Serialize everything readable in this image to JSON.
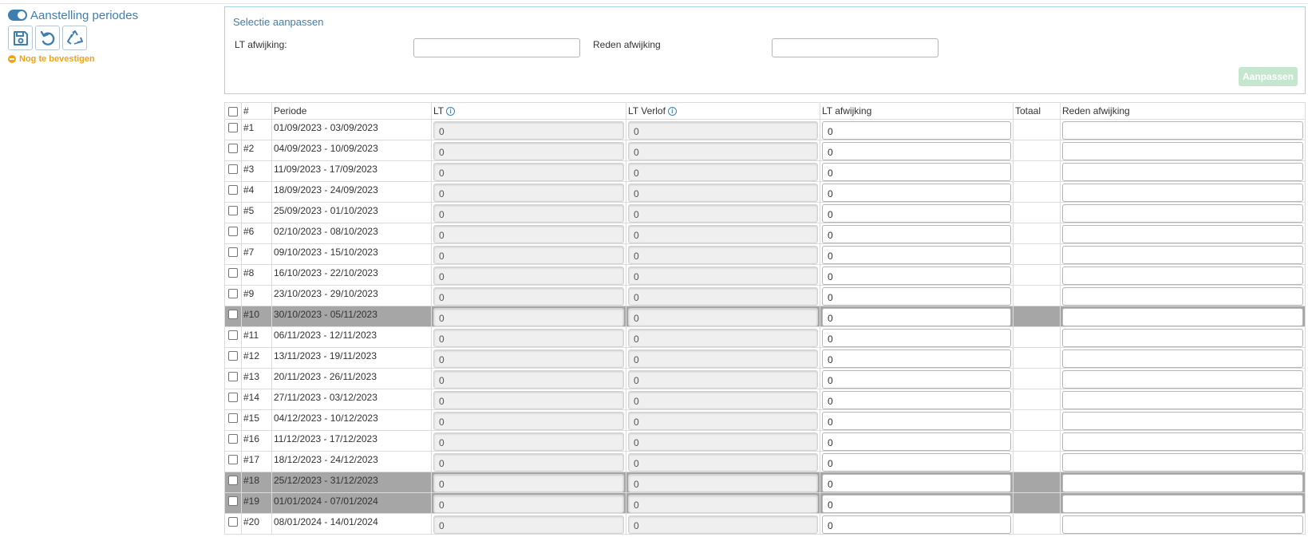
{
  "left": {
    "title": "Aanstelling periodes",
    "toggle_icon": "toggle-icon",
    "buttons": [
      "save-icon",
      "undo-icon",
      "recycle-icon"
    ],
    "status": "Nog te bevestigen",
    "status_color": "#f0a31a"
  },
  "selection": {
    "title": "Selectie aanpassen",
    "lt_label": "LT afwijking:",
    "lt_value": "",
    "reason_label": "Reden afwijking",
    "reason_value": "",
    "apply_label": "Aanpassen"
  },
  "table": {
    "headers": {
      "num": "#",
      "period": "Periode",
      "lt": "LT",
      "leave": "LT Verlof",
      "deviation": "LT afwijking",
      "total": "Totaal",
      "reason": "Reden afwijking"
    },
    "rows": [
      {
        "num": "#1",
        "period": "01/09/2023 - 03/09/2023",
        "lt": "0",
        "leave": "0",
        "deviation": "0",
        "total": "",
        "reason": "",
        "highlight": false
      },
      {
        "num": "#2",
        "period": "04/09/2023 - 10/09/2023",
        "lt": "0",
        "leave": "0",
        "deviation": "0",
        "total": "",
        "reason": "",
        "highlight": false
      },
      {
        "num": "#3",
        "period": "11/09/2023 - 17/09/2023",
        "lt": "0",
        "leave": "0",
        "deviation": "0",
        "total": "",
        "reason": "",
        "highlight": false
      },
      {
        "num": "#4",
        "period": "18/09/2023 - 24/09/2023",
        "lt": "0",
        "leave": "0",
        "deviation": "0",
        "total": "",
        "reason": "",
        "highlight": false
      },
      {
        "num": "#5",
        "period": "25/09/2023 - 01/10/2023",
        "lt": "0",
        "leave": "0",
        "deviation": "0",
        "total": "",
        "reason": "",
        "highlight": false
      },
      {
        "num": "#6",
        "period": "02/10/2023 - 08/10/2023",
        "lt": "0",
        "leave": "0",
        "deviation": "0",
        "total": "",
        "reason": "",
        "highlight": false
      },
      {
        "num": "#7",
        "period": "09/10/2023 - 15/10/2023",
        "lt": "0",
        "leave": "0",
        "deviation": "0",
        "total": "",
        "reason": "",
        "highlight": false
      },
      {
        "num": "#8",
        "period": "16/10/2023 - 22/10/2023",
        "lt": "0",
        "leave": "0",
        "deviation": "0",
        "total": "",
        "reason": "",
        "highlight": false
      },
      {
        "num": "#9",
        "period": "23/10/2023 - 29/10/2023",
        "lt": "0",
        "leave": "0",
        "deviation": "0",
        "total": "",
        "reason": "",
        "highlight": false
      },
      {
        "num": "#10",
        "period": "30/10/2023 - 05/11/2023",
        "lt": "0",
        "leave": "0",
        "deviation": "0",
        "total": "",
        "reason": "",
        "highlight": true
      },
      {
        "num": "#11",
        "period": "06/11/2023 - 12/11/2023",
        "lt": "0",
        "leave": "0",
        "deviation": "0",
        "total": "",
        "reason": "",
        "highlight": false
      },
      {
        "num": "#12",
        "period": "13/11/2023 - 19/11/2023",
        "lt": "0",
        "leave": "0",
        "deviation": "0",
        "total": "",
        "reason": "",
        "highlight": false
      },
      {
        "num": "#13",
        "period": "20/11/2023 - 26/11/2023",
        "lt": "0",
        "leave": "0",
        "deviation": "0",
        "total": "",
        "reason": "",
        "highlight": false
      },
      {
        "num": "#14",
        "period": "27/11/2023 - 03/12/2023",
        "lt": "0",
        "leave": "0",
        "deviation": "0",
        "total": "",
        "reason": "",
        "highlight": false
      },
      {
        "num": "#15",
        "period": "04/12/2023 - 10/12/2023",
        "lt": "0",
        "leave": "0",
        "deviation": "0",
        "total": "",
        "reason": "",
        "highlight": false
      },
      {
        "num": "#16",
        "period": "11/12/2023 - 17/12/2023",
        "lt": "0",
        "leave": "0",
        "deviation": "0",
        "total": "",
        "reason": "",
        "highlight": false
      },
      {
        "num": "#17",
        "period": "18/12/2023 - 24/12/2023",
        "lt": "0",
        "leave": "0",
        "deviation": "0",
        "total": "",
        "reason": "",
        "highlight": false
      },
      {
        "num": "#18",
        "period": "25/12/2023 - 31/12/2023",
        "lt": "0",
        "leave": "0",
        "deviation": "0",
        "total": "",
        "reason": "",
        "highlight": true
      },
      {
        "num": "#19",
        "period": "01/01/2024 - 07/01/2024",
        "lt": "0",
        "leave": "0",
        "deviation": "0",
        "total": "",
        "reason": "",
        "highlight": true
      },
      {
        "num": "#20",
        "period": "08/01/2024 - 14/01/2024",
        "lt": "0",
        "leave": "0",
        "deviation": "0",
        "total": "",
        "reason": "",
        "highlight": false
      }
    ]
  },
  "colors": {
    "accent": "#3f7fb0",
    "highlight_row": "#a6a6a6",
    "apply_button": "#c5e7cf"
  }
}
